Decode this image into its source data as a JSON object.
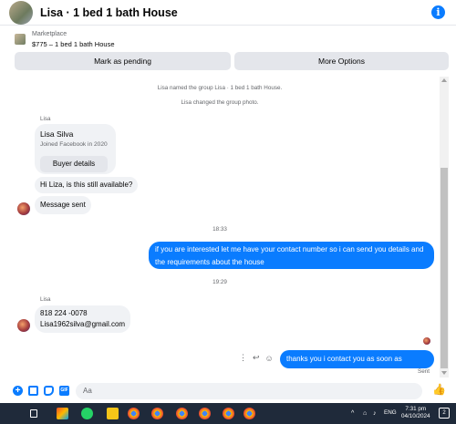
{
  "header": {
    "title": "Lisa · 1 bed 1 bath House",
    "info_icon": "info-icon",
    "info_glyph": "i"
  },
  "marketplace": {
    "label": "Marketplace",
    "item": "$775 – 1 bed 1 bath House",
    "pending_button": "Mark as pending",
    "more_button": "More Options"
  },
  "conversation": {
    "system_messages": [
      "Lisa named the group Lisa · 1 bed 1 bath House.",
      "Lisa changed the group photo."
    ],
    "sender_name": "Lisa",
    "profile_card": {
      "name": "Lisa Silva",
      "joined": "Joined Facebook in 2020",
      "button": "Buyer details"
    },
    "incoming_1": "Hi Liza, is this still available?",
    "incoming_2": "Message sent",
    "time_1": "18:33",
    "outgoing_1_line1": "if you are interested let me have your contact number so i can send you details and",
    "outgoing_1_line2": "the requirements about the house",
    "time_2": "19:29",
    "sender_name_2": "Lisa",
    "incoming_3_line1": "818 224 -0078",
    "incoming_3_line2": "Lisa1962silva@gmail.com",
    "outgoing_2": "thanks you i contact you as soon as possible",
    "status": "Sent",
    "action_glyphs": {
      "more": "⋮",
      "reply": "↩",
      "react": "☺"
    }
  },
  "composer": {
    "placeholder": "Aa",
    "plus_glyph": "+",
    "gif_glyph": "GIF",
    "like_glyph": "👍"
  },
  "taskbar": {
    "lang": "ENG",
    "time": "7:31 pm",
    "date": "04/10/2024",
    "notification_count": "2",
    "tray_glyphs": {
      "chevron": "^",
      "network": "⌂",
      "volume": "♪"
    },
    "colors": {
      "bg": "#1f2a3a"
    }
  },
  "colors": {
    "accent": "#0a7cff",
    "bubble_in": "#f0f2f5",
    "button": "#e4e6eb"
  }
}
